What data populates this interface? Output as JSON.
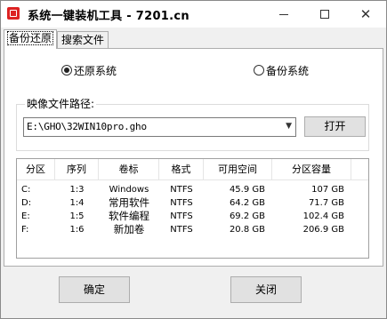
{
  "window": {
    "title": "系统一键装机工具 - 7201.cn"
  },
  "tabs": [
    {
      "label": "备份还原",
      "active": true
    },
    {
      "label": "搜索文件",
      "active": false
    }
  ],
  "mode": {
    "restore_label": "还原系统",
    "backup_label": "备份系统",
    "selected": "restore"
  },
  "image_path": {
    "group_label": "映像文件路径:",
    "value": "E:\\GHO\\32WIN10pro.gho",
    "open_label": "打开"
  },
  "partitions": {
    "columns": [
      "分区",
      "序列",
      "卷标",
      "格式",
      "可用空间",
      "分区容量"
    ],
    "rows": [
      {
        "drive": "C:",
        "seq": "1:3",
        "label": "Windows",
        "format": "NTFS",
        "free": "45.9 GB",
        "size": "107 GB"
      },
      {
        "drive": "D:",
        "seq": "1:4",
        "label": "常用软件",
        "format": "NTFS",
        "free": "64.2 GB",
        "size": "71.7 GB"
      },
      {
        "drive": "E:",
        "seq": "1:5",
        "label": "软件编程",
        "format": "NTFS",
        "free": "69.2 GB",
        "size": "102.4 GB"
      },
      {
        "drive": "F:",
        "seq": "1:6",
        "label": "新加卷",
        "format": "NTFS",
        "free": "20.8 GB",
        "size": "206.9 GB"
      }
    ]
  },
  "buttons": {
    "ok_label": "确定",
    "close_label": "关闭"
  }
}
